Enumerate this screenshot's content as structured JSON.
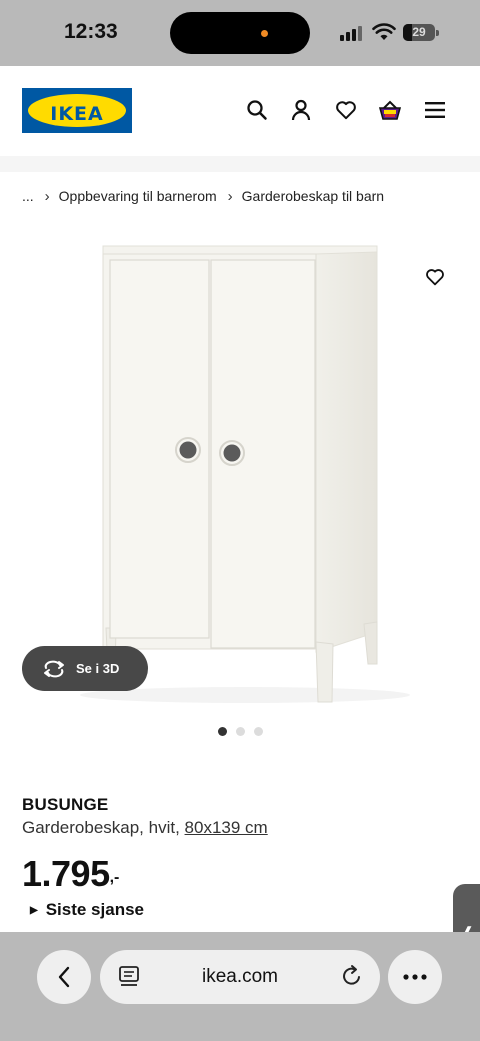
{
  "status_bar": {
    "time": "12:33",
    "battery": "29",
    "battery_level": 0.29
  },
  "header": {
    "logo_text": "IKEA",
    "icons": [
      "search-icon",
      "account-icon",
      "heart-icon",
      "basket-icon",
      "menu-icon"
    ]
  },
  "breadcrumb": {
    "items": [
      "...",
      "Oppbevaring til barnerom",
      "Garderobeskap til barn"
    ]
  },
  "gallery": {
    "view_3d_label": "Se i 3D",
    "slides": 3,
    "active_slide": 1
  },
  "product": {
    "name": "BUSUNGE",
    "description": "Garderobeskap, hvit,",
    "size": "80x139 cm",
    "price": "1.795",
    "price_suffix": ",-",
    "tag": "Siste sjanse"
  },
  "browser": {
    "url": "ikea.com"
  },
  "colors": {
    "brand_blue": "#0058a3",
    "brand_yellow": "#ffdb00",
    "chrome_grey": "#b9b9b9"
  }
}
